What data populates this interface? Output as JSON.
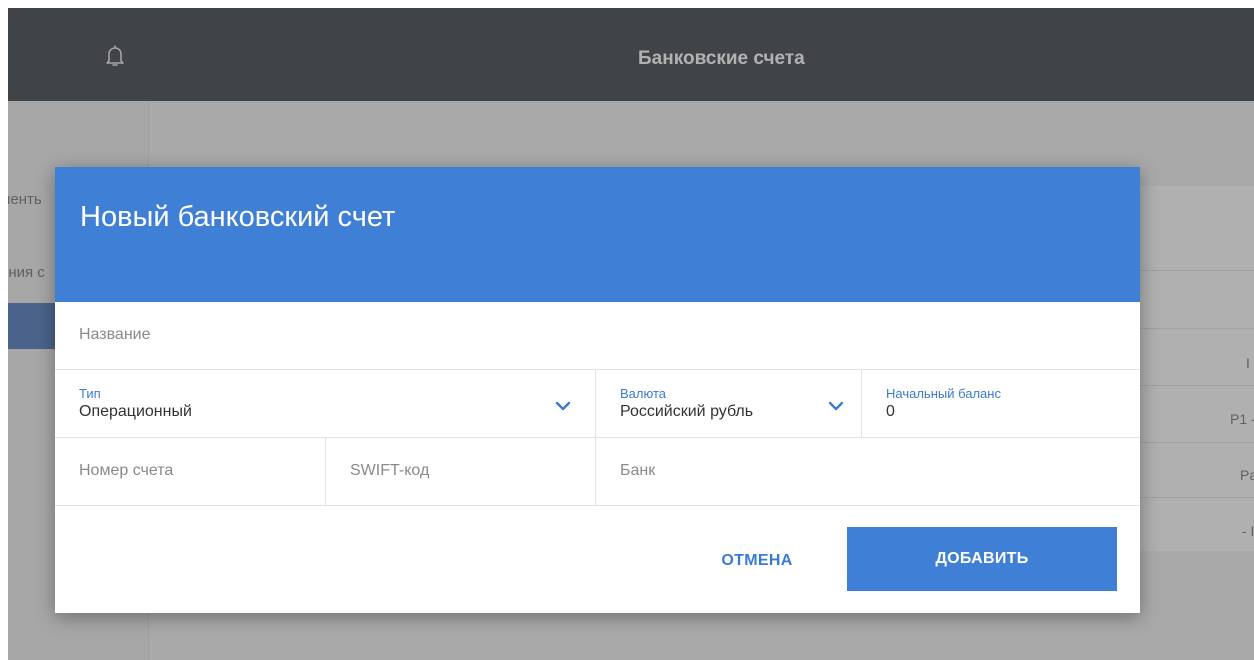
{
  "header": {
    "title": "Банковские счета",
    "icon": "bell-icon"
  },
  "background": {
    "sidebar_items": [
      "иенть",
      "ения с"
    ],
    "edge_texts": [
      "I",
      "P1 -",
      "Pa",
      "- I"
    ]
  },
  "dialog": {
    "title": "Новый банковский счет",
    "name_placeholder": "Название",
    "type": {
      "label": "Тип",
      "value": "Операционный"
    },
    "currency": {
      "label": "Валюта",
      "value": "Российский рубль"
    },
    "opening_balance": {
      "label": "Начальный баланс",
      "value": "0"
    },
    "account_number_placeholder": "Номер счета",
    "swift_placeholder": "SWIFT-код",
    "bank_placeholder": "Банк",
    "cancel_label": "ОТМЕНА",
    "add_label": "ДОБАВИТЬ"
  },
  "colors": {
    "accent": "#3f80d6",
    "topbar": "#1b2029"
  }
}
